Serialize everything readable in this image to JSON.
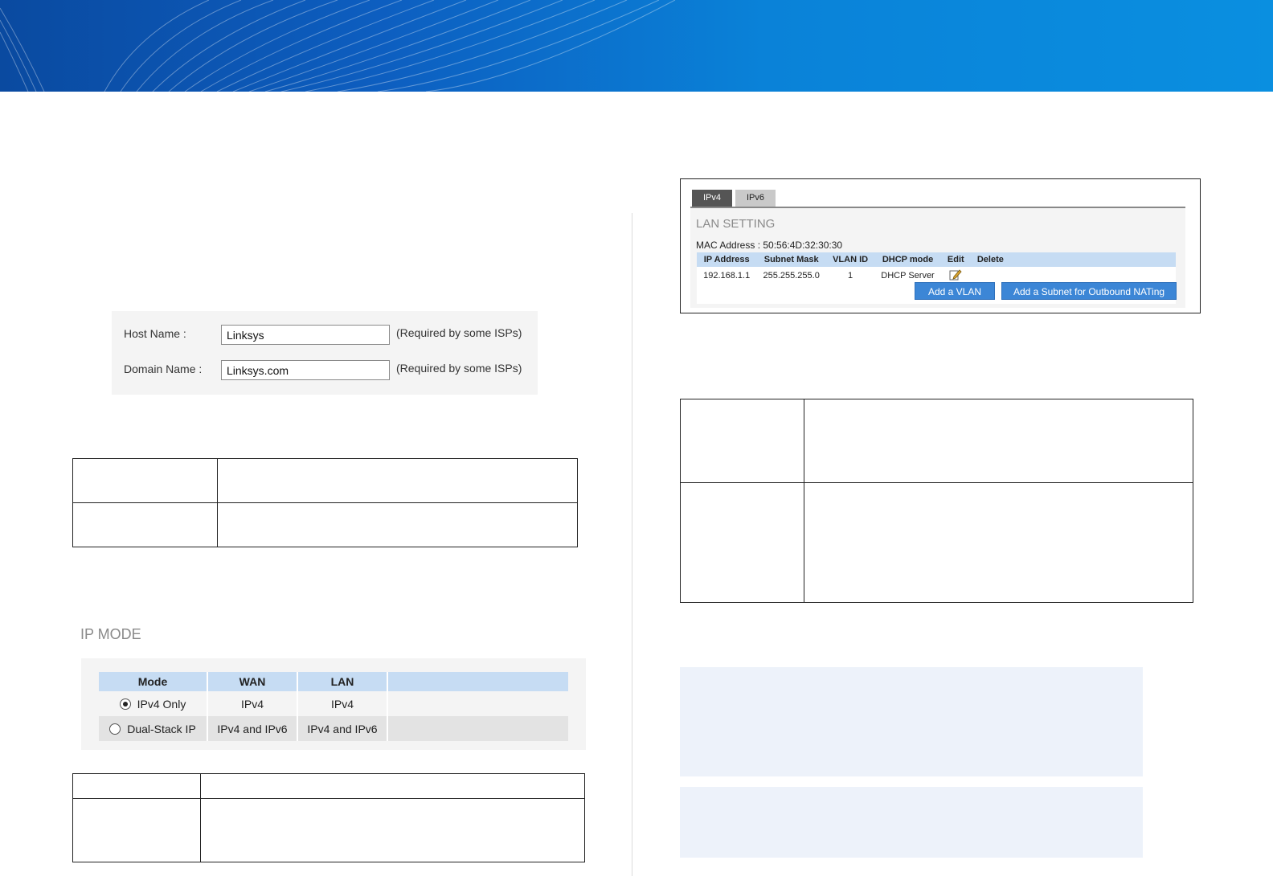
{
  "host_form": {
    "host_label": "Host Name :",
    "host_value": "Linksys",
    "domain_label": "Domain Name :",
    "domain_value": "Linksys.com",
    "hint": "(Required by some ISPs)"
  },
  "lan_setting": {
    "tabs": [
      "IPv4",
      "IPv6"
    ],
    "title": "LAN SETTING",
    "mac": "MAC Address : 50:56:4D:32:30:30",
    "headers": [
      "IP Address",
      "Subnet Mask",
      "VLAN ID",
      "DHCP mode",
      "Edit",
      "Delete"
    ],
    "row": {
      "ip": "192.168.1.1",
      "mask": "255.255.255.0",
      "vlan": "1",
      "dhcp": "DHCP Server"
    },
    "add_vlan": "Add a VLAN",
    "add_subnet": "Add a Subnet for Outbound NATing"
  },
  "ip_mode": {
    "title": "IP MODE",
    "headers": [
      "Mode",
      "WAN",
      "LAN"
    ],
    "rows": [
      {
        "mode": "IPv4 Only",
        "wan": "IPv4",
        "lan": "IPv4",
        "selected": true
      },
      {
        "mode": "Dual-Stack IP",
        "wan": "IPv4 and IPv6",
        "lan": "IPv4 and IPv6",
        "selected": false
      }
    ]
  },
  "icons": {
    "edit": "edit-pencil-icon"
  },
  "colors": {
    "banner": "#0a82d8",
    "header_blue": "#c6dcf3",
    "button_blue": "#3c86d6",
    "note_bg": "#edf2fa"
  }
}
